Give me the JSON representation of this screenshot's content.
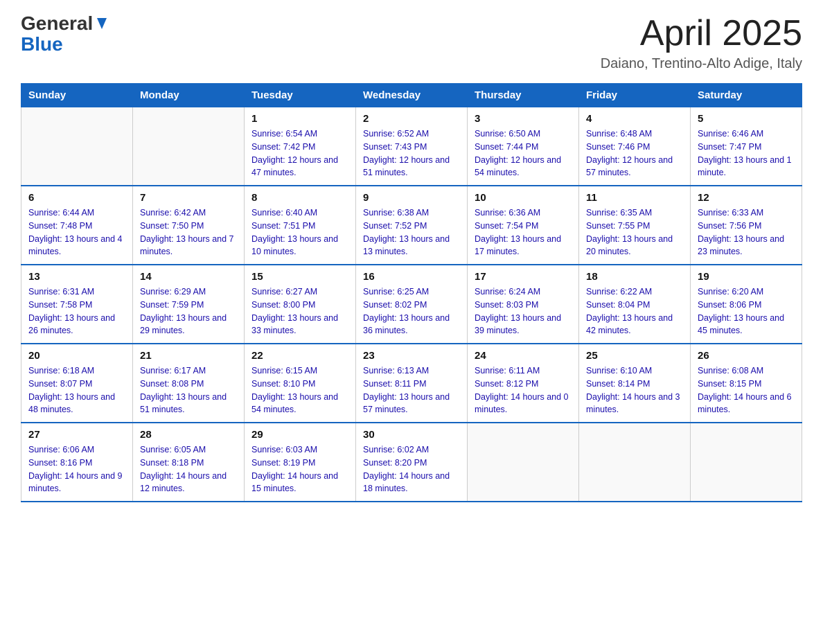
{
  "header": {
    "logo_general": "General",
    "logo_blue": "Blue",
    "title": "April 2025",
    "subtitle": "Daiano, Trentino-Alto Adige, Italy"
  },
  "days_of_week": [
    "Sunday",
    "Monday",
    "Tuesday",
    "Wednesday",
    "Thursday",
    "Friday",
    "Saturday"
  ],
  "weeks": [
    [
      {
        "day": "",
        "sunrise": "",
        "sunset": "",
        "daylight": ""
      },
      {
        "day": "",
        "sunrise": "",
        "sunset": "",
        "daylight": ""
      },
      {
        "day": "1",
        "sunrise": "Sunrise: 6:54 AM",
        "sunset": "Sunset: 7:42 PM",
        "daylight": "Daylight: 12 hours and 47 minutes."
      },
      {
        "day": "2",
        "sunrise": "Sunrise: 6:52 AM",
        "sunset": "Sunset: 7:43 PM",
        "daylight": "Daylight: 12 hours and 51 minutes."
      },
      {
        "day": "3",
        "sunrise": "Sunrise: 6:50 AM",
        "sunset": "Sunset: 7:44 PM",
        "daylight": "Daylight: 12 hours and 54 minutes."
      },
      {
        "day": "4",
        "sunrise": "Sunrise: 6:48 AM",
        "sunset": "Sunset: 7:46 PM",
        "daylight": "Daylight: 12 hours and 57 minutes."
      },
      {
        "day": "5",
        "sunrise": "Sunrise: 6:46 AM",
        "sunset": "Sunset: 7:47 PM",
        "daylight": "Daylight: 13 hours and 1 minute."
      }
    ],
    [
      {
        "day": "6",
        "sunrise": "Sunrise: 6:44 AM",
        "sunset": "Sunset: 7:48 PM",
        "daylight": "Daylight: 13 hours and 4 minutes."
      },
      {
        "day": "7",
        "sunrise": "Sunrise: 6:42 AM",
        "sunset": "Sunset: 7:50 PM",
        "daylight": "Daylight: 13 hours and 7 minutes."
      },
      {
        "day": "8",
        "sunrise": "Sunrise: 6:40 AM",
        "sunset": "Sunset: 7:51 PM",
        "daylight": "Daylight: 13 hours and 10 minutes."
      },
      {
        "day": "9",
        "sunrise": "Sunrise: 6:38 AM",
        "sunset": "Sunset: 7:52 PM",
        "daylight": "Daylight: 13 hours and 13 minutes."
      },
      {
        "day": "10",
        "sunrise": "Sunrise: 6:36 AM",
        "sunset": "Sunset: 7:54 PM",
        "daylight": "Daylight: 13 hours and 17 minutes."
      },
      {
        "day": "11",
        "sunrise": "Sunrise: 6:35 AM",
        "sunset": "Sunset: 7:55 PM",
        "daylight": "Daylight: 13 hours and 20 minutes."
      },
      {
        "day": "12",
        "sunrise": "Sunrise: 6:33 AM",
        "sunset": "Sunset: 7:56 PM",
        "daylight": "Daylight: 13 hours and 23 minutes."
      }
    ],
    [
      {
        "day": "13",
        "sunrise": "Sunrise: 6:31 AM",
        "sunset": "Sunset: 7:58 PM",
        "daylight": "Daylight: 13 hours and 26 minutes."
      },
      {
        "day": "14",
        "sunrise": "Sunrise: 6:29 AM",
        "sunset": "Sunset: 7:59 PM",
        "daylight": "Daylight: 13 hours and 29 minutes."
      },
      {
        "day": "15",
        "sunrise": "Sunrise: 6:27 AM",
        "sunset": "Sunset: 8:00 PM",
        "daylight": "Daylight: 13 hours and 33 minutes."
      },
      {
        "day": "16",
        "sunrise": "Sunrise: 6:25 AM",
        "sunset": "Sunset: 8:02 PM",
        "daylight": "Daylight: 13 hours and 36 minutes."
      },
      {
        "day": "17",
        "sunrise": "Sunrise: 6:24 AM",
        "sunset": "Sunset: 8:03 PM",
        "daylight": "Daylight: 13 hours and 39 minutes."
      },
      {
        "day": "18",
        "sunrise": "Sunrise: 6:22 AM",
        "sunset": "Sunset: 8:04 PM",
        "daylight": "Daylight: 13 hours and 42 minutes."
      },
      {
        "day": "19",
        "sunrise": "Sunrise: 6:20 AM",
        "sunset": "Sunset: 8:06 PM",
        "daylight": "Daylight: 13 hours and 45 minutes."
      }
    ],
    [
      {
        "day": "20",
        "sunrise": "Sunrise: 6:18 AM",
        "sunset": "Sunset: 8:07 PM",
        "daylight": "Daylight: 13 hours and 48 minutes."
      },
      {
        "day": "21",
        "sunrise": "Sunrise: 6:17 AM",
        "sunset": "Sunset: 8:08 PM",
        "daylight": "Daylight: 13 hours and 51 minutes."
      },
      {
        "day": "22",
        "sunrise": "Sunrise: 6:15 AM",
        "sunset": "Sunset: 8:10 PM",
        "daylight": "Daylight: 13 hours and 54 minutes."
      },
      {
        "day": "23",
        "sunrise": "Sunrise: 6:13 AM",
        "sunset": "Sunset: 8:11 PM",
        "daylight": "Daylight: 13 hours and 57 minutes."
      },
      {
        "day": "24",
        "sunrise": "Sunrise: 6:11 AM",
        "sunset": "Sunset: 8:12 PM",
        "daylight": "Daylight: 14 hours and 0 minutes."
      },
      {
        "day": "25",
        "sunrise": "Sunrise: 6:10 AM",
        "sunset": "Sunset: 8:14 PM",
        "daylight": "Daylight: 14 hours and 3 minutes."
      },
      {
        "day": "26",
        "sunrise": "Sunrise: 6:08 AM",
        "sunset": "Sunset: 8:15 PM",
        "daylight": "Daylight: 14 hours and 6 minutes."
      }
    ],
    [
      {
        "day": "27",
        "sunrise": "Sunrise: 6:06 AM",
        "sunset": "Sunset: 8:16 PM",
        "daylight": "Daylight: 14 hours and 9 minutes."
      },
      {
        "day": "28",
        "sunrise": "Sunrise: 6:05 AM",
        "sunset": "Sunset: 8:18 PM",
        "daylight": "Daylight: 14 hours and 12 minutes."
      },
      {
        "day": "29",
        "sunrise": "Sunrise: 6:03 AM",
        "sunset": "Sunset: 8:19 PM",
        "daylight": "Daylight: 14 hours and 15 minutes."
      },
      {
        "day": "30",
        "sunrise": "Sunrise: 6:02 AM",
        "sunset": "Sunset: 8:20 PM",
        "daylight": "Daylight: 14 hours and 18 minutes."
      },
      {
        "day": "",
        "sunrise": "",
        "sunset": "",
        "daylight": ""
      },
      {
        "day": "",
        "sunrise": "",
        "sunset": "",
        "daylight": ""
      },
      {
        "day": "",
        "sunrise": "",
        "sunset": "",
        "daylight": ""
      }
    ]
  ]
}
